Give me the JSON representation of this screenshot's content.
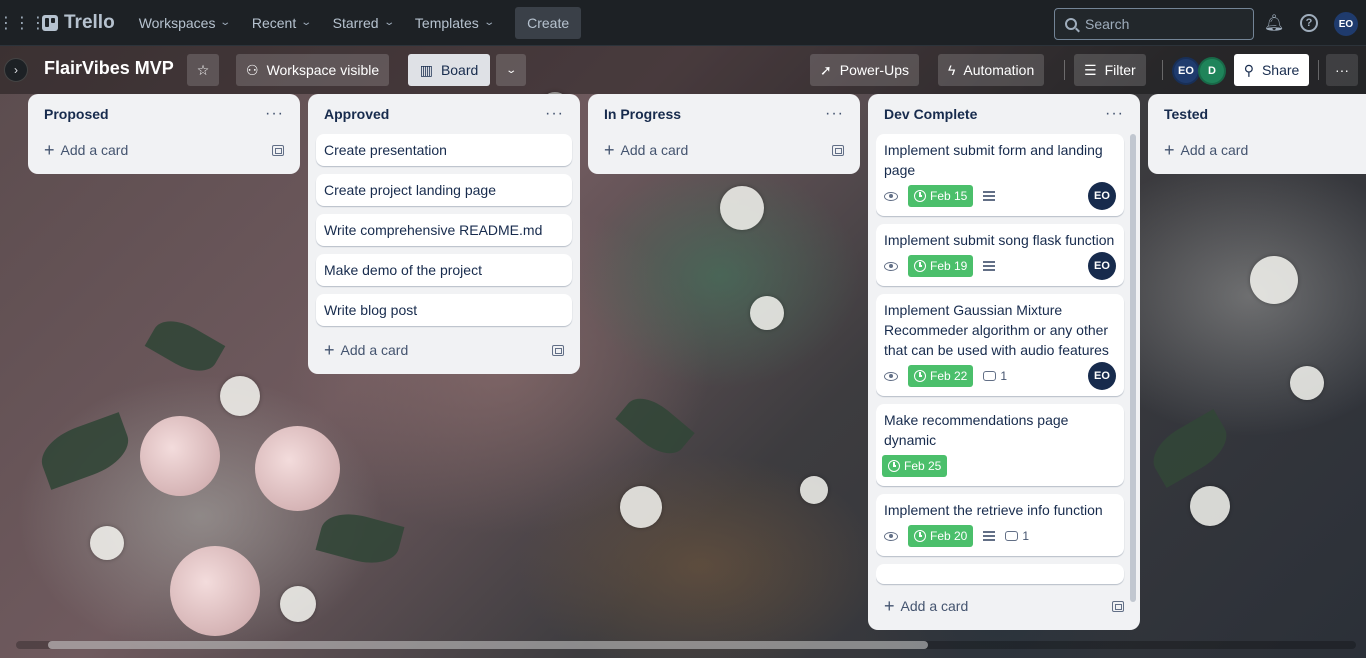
{
  "topbar": {
    "logo": "Trello",
    "nav": [
      {
        "label": "Workspaces"
      },
      {
        "label": "Recent"
      },
      {
        "label": "Starred"
      },
      {
        "label": "Templates"
      }
    ],
    "create_label": "Create",
    "search_placeholder": "Search",
    "user_initials": "EO"
  },
  "board": {
    "title": "FlairVibes MVP",
    "visibility_label": "Workspace visible",
    "view_label": "Board",
    "powerups_label": "Power-Ups",
    "automation_label": "Automation",
    "filter_label": "Filter",
    "share_label": "Share",
    "members": [
      "EO",
      "D"
    ]
  },
  "lists": [
    {
      "title": "Proposed",
      "add_label": "Add a card",
      "cards": []
    },
    {
      "title": "Approved",
      "add_label": "Add a card",
      "cards": [
        {
          "title": "Create presentation"
        },
        {
          "title": "Create project landing page"
        },
        {
          "title": "Write comprehensive README.md"
        },
        {
          "title": "Make demo of the project"
        },
        {
          "title": "Write blog post"
        }
      ]
    },
    {
      "title": "In Progress",
      "add_label": "Add a card",
      "cards": []
    },
    {
      "title": "Dev Complete",
      "add_label": "Add a card",
      "cards": [
        {
          "title": "Implement submit form and landing page",
          "due": "Feb 15",
          "member": "EO"
        },
        {
          "title": "Implement submit song flask function",
          "due": "Feb 19",
          "member": "EO"
        },
        {
          "title": "Implement Gaussian Mixture Recommeder algorithm or any other that can be used with audio features",
          "due": "Feb 22",
          "comments": "1",
          "member": "EO"
        },
        {
          "title": "Make recommendations page dynamic",
          "due": "Feb 25"
        },
        {
          "title": "Implement the retrieve info function",
          "due": "Feb 20",
          "comments": "1"
        }
      ]
    },
    {
      "title": "Tested",
      "add_label": "Add a card",
      "cards": []
    }
  ],
  "colors": {
    "topbar_bg": "#1d2125",
    "list_bg": "#f1f2f4",
    "due_complete": "#4bbf6b",
    "avatar_eo": "#1f3b6d",
    "avatar_d": "#1f845a"
  }
}
